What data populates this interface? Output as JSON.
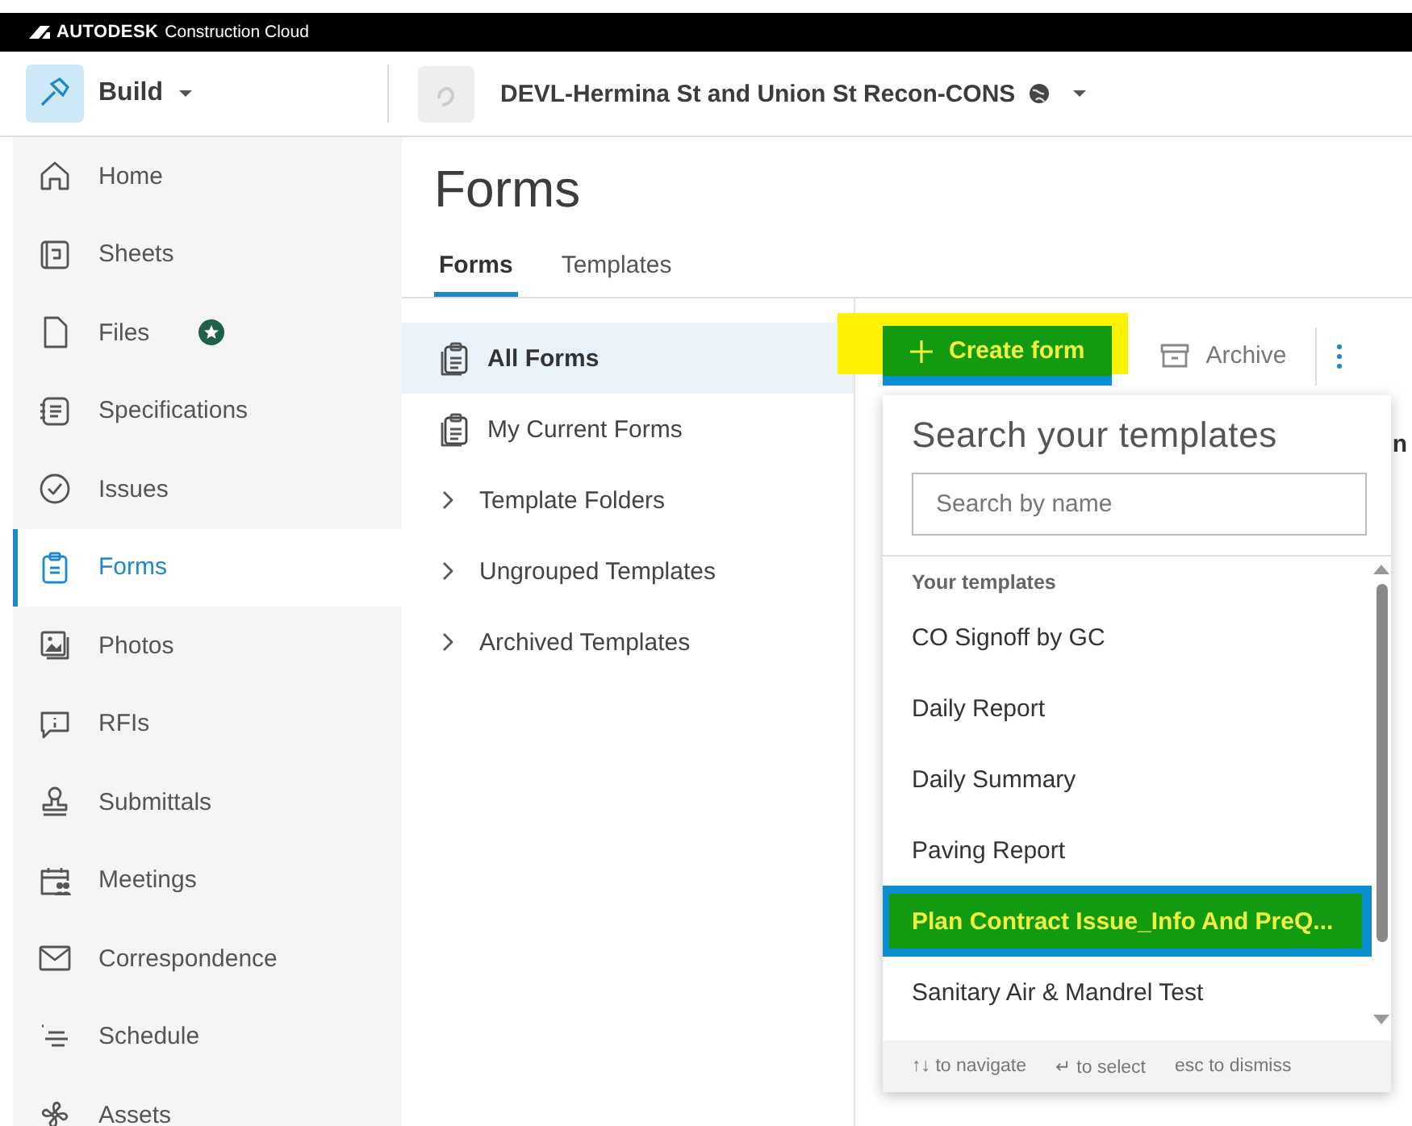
{
  "brand": {
    "logo": "AUTODESK",
    "product": "Construction Cloud"
  },
  "header": {
    "module": "Build",
    "project": "DEVL-Hermina St and Union St Recon-CONS"
  },
  "sidebar": {
    "items": [
      {
        "label": "Home",
        "selected": false,
        "starred": false
      },
      {
        "label": "Sheets",
        "selected": false,
        "starred": false
      },
      {
        "label": "Files",
        "selected": false,
        "starred": true
      },
      {
        "label": "Specifications",
        "selected": false,
        "starred": false
      },
      {
        "label": "Issues",
        "selected": false,
        "starred": false
      },
      {
        "label": "Forms",
        "selected": true,
        "starred": false
      },
      {
        "label": "Photos",
        "selected": false,
        "starred": false
      },
      {
        "label": "RFIs",
        "selected": false,
        "starred": false
      },
      {
        "label": "Submittals",
        "selected": false,
        "starred": false
      },
      {
        "label": "Meetings",
        "selected": false,
        "starred": false
      },
      {
        "label": "Correspondence",
        "selected": false,
        "starred": false
      },
      {
        "label": "Schedule",
        "selected": false,
        "starred": false
      },
      {
        "label": "Assets",
        "selected": false,
        "starred": false
      }
    ]
  },
  "page": {
    "title": "Forms"
  },
  "tabs": [
    {
      "label": "Forms",
      "selected": true
    },
    {
      "label": "Templates",
      "selected": false
    }
  ],
  "form_nav": [
    {
      "label": "All Forms",
      "kind": "view",
      "selected": true
    },
    {
      "label": "My Current Forms",
      "kind": "view",
      "selected": false
    },
    {
      "label": "Template Folders",
      "kind": "group",
      "selected": false
    },
    {
      "label": "Ungrouped Templates",
      "kind": "group",
      "selected": false
    },
    {
      "label": "Archived Templates",
      "kind": "group",
      "selected": false
    }
  ],
  "toolbar": {
    "create_button": {
      "label": "Create form",
      "highlighted": true
    },
    "archive_button": "Archive"
  },
  "table": {
    "columns": [
      "n"
    ]
  },
  "template_menu": {
    "title": "Search your templates",
    "search": {
      "placeholder": "Search by name"
    },
    "section": "Your templates",
    "items": [
      {
        "label": "CO Signoff by GC",
        "selected": false,
        "highlighted": false
      },
      {
        "label": "Daily Report",
        "selected": false,
        "highlighted": false
      },
      {
        "label": "Daily Summary",
        "selected": false,
        "highlighted": false
      },
      {
        "label": "Paving Report",
        "selected": false,
        "highlighted": false
      },
      {
        "label": "Plan Contract Issue_Info And PreQ...",
        "selected": true,
        "highlighted": true
      },
      {
        "label": "Sanitary Air & Mandrel Test",
        "selected": false,
        "highlighted": false
      }
    ],
    "hints": [
      {
        "key": "↑↓",
        "text": "to navigate"
      },
      {
        "key": "↵",
        "text": "to select"
      },
      {
        "key": "esc",
        "text": "to dismiss"
      }
    ]
  }
}
